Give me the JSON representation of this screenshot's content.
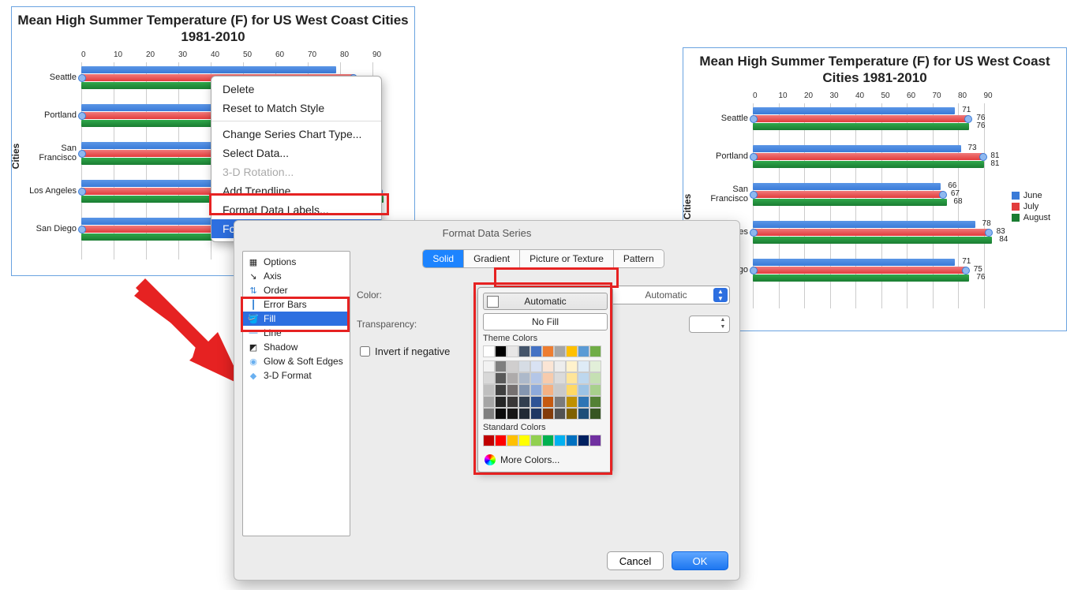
{
  "chart_data": [
    {
      "type": "bar",
      "orientation": "horizontal",
      "title": "Mean High Summer Temperature (F) for US West Coast Cities 1981-2010",
      "ylabel": "Cities",
      "xlim": [
        0,
        90
      ],
      "xticks": [
        0,
        10,
        20,
        30,
        40,
        50,
        60,
        70,
        80,
        90
      ],
      "categories": [
        "Seattle",
        "Portland",
        "San Francisco",
        "Los Angeles",
        "San Diego"
      ],
      "series": [
        {
          "name": "June",
          "values": [
            71,
            73,
            66,
            78,
            71
          ],
          "color": "#3a7bd8"
        },
        {
          "name": "July",
          "values": [
            76,
            81,
            67,
            83,
            75
          ],
          "color": "#e23c3c"
        },
        {
          "name": "August",
          "values": [
            76,
            81,
            68,
            84,
            76
          ],
          "color": "#1a7d32"
        }
      ],
      "note": "left chart shows default gradient styling; July series selected"
    },
    {
      "type": "bar",
      "orientation": "horizontal",
      "title": "Mean High Summer Temperature (F) for US West Coast Cities 1981-2010",
      "ylabel": "Cities",
      "xlim": [
        0,
        90
      ],
      "xticks": [
        0,
        10,
        20,
        30,
        40,
        50,
        60,
        70,
        80,
        90
      ],
      "categories": [
        "Seattle",
        "Portland",
        "San Francisco",
        "Los Angeles",
        "San Diego"
      ],
      "series": [
        {
          "name": "June",
          "values": [
            71,
            73,
            66,
            78,
            71
          ],
          "color": "#3a7bd8"
        },
        {
          "name": "July",
          "values": [
            76,
            81,
            67,
            83,
            75
          ],
          "color": "#e23c3c"
        },
        {
          "name": "August",
          "values": [
            76,
            81,
            68,
            84,
            76
          ],
          "color": "#1a7d32"
        }
      ],
      "legend": [
        "June",
        "July",
        "August"
      ],
      "note": "right chart shows solid colors with data labels"
    }
  ],
  "context_menu": {
    "items": [
      "Delete",
      "Reset to Match Style",
      "Change Series Chart Type...",
      "Select Data...",
      "3-D Rotation...",
      "Add Trendline...",
      "Format Data Labels...",
      "Format Data Series..."
    ],
    "disabled": [
      "3-D Rotation..."
    ],
    "highlighted": "Format Data Series..."
  },
  "dialog": {
    "title": "Format Data Series",
    "tree": [
      "Options",
      "Axis",
      "Order",
      "Error Bars",
      "Fill",
      "Line",
      "Shadow",
      "Glow & Soft Edges",
      "3-D Format"
    ],
    "tree_selected": "Fill",
    "fill_tabs": [
      "Solid",
      "Gradient",
      "Picture or Texture",
      "Pattern"
    ],
    "fill_tab_selected": "Solid",
    "color_label": "Color:",
    "color_value": "Automatic",
    "transparency_label": "Transparency:",
    "invert_label": "Invert if negative",
    "cancel": "Cancel",
    "ok": "OK"
  },
  "color_popover": {
    "automatic": "Automatic",
    "no_fill": "No Fill",
    "theme_label": "Theme Colors",
    "theme_colors_row1": [
      "#ffffff",
      "#000000",
      "#e7e6e6",
      "#44546a",
      "#4472c4",
      "#ed7d31",
      "#a5a5a5",
      "#ffc000",
      "#5b9bd5",
      "#70ad47"
    ],
    "theme_tints": [
      [
        "#f2f2f2",
        "#7f7f7f",
        "#d0cece",
        "#d6dce4",
        "#d9e2f3",
        "#fbe5d5",
        "#ededed",
        "#fff2cc",
        "#deebf6",
        "#e2efd9"
      ],
      [
        "#d8d8d8",
        "#595959",
        "#aeabab",
        "#adb9ca",
        "#b4c6e7",
        "#f7cbac",
        "#dbdbdb",
        "#fee599",
        "#bdd7ee",
        "#c5e0b3"
      ],
      [
        "#bfbfbf",
        "#3f3f3f",
        "#757070",
        "#8496b0",
        "#8eaadb",
        "#f4b183",
        "#c9c9c9",
        "#ffd965",
        "#9cc3e5",
        "#a8d08d"
      ],
      [
        "#a5a5a5",
        "#262626",
        "#3a3838",
        "#323f4f",
        "#2f5496",
        "#c55a11",
        "#7b7b7b",
        "#bf9000",
        "#2e75b5",
        "#538135"
      ],
      [
        "#7f7f7f",
        "#0c0c0c",
        "#171616",
        "#222a35",
        "#1f3864",
        "#833c0b",
        "#525252",
        "#7f6000",
        "#1e4e79",
        "#375623"
      ]
    ],
    "standard_label": "Standard Colors",
    "standard_colors": [
      "#c00000",
      "#ff0000",
      "#ffc000",
      "#ffff00",
      "#92d050",
      "#00b050",
      "#00b0f0",
      "#0070c0",
      "#002060",
      "#7030a0"
    ],
    "more": "More Colors..."
  }
}
